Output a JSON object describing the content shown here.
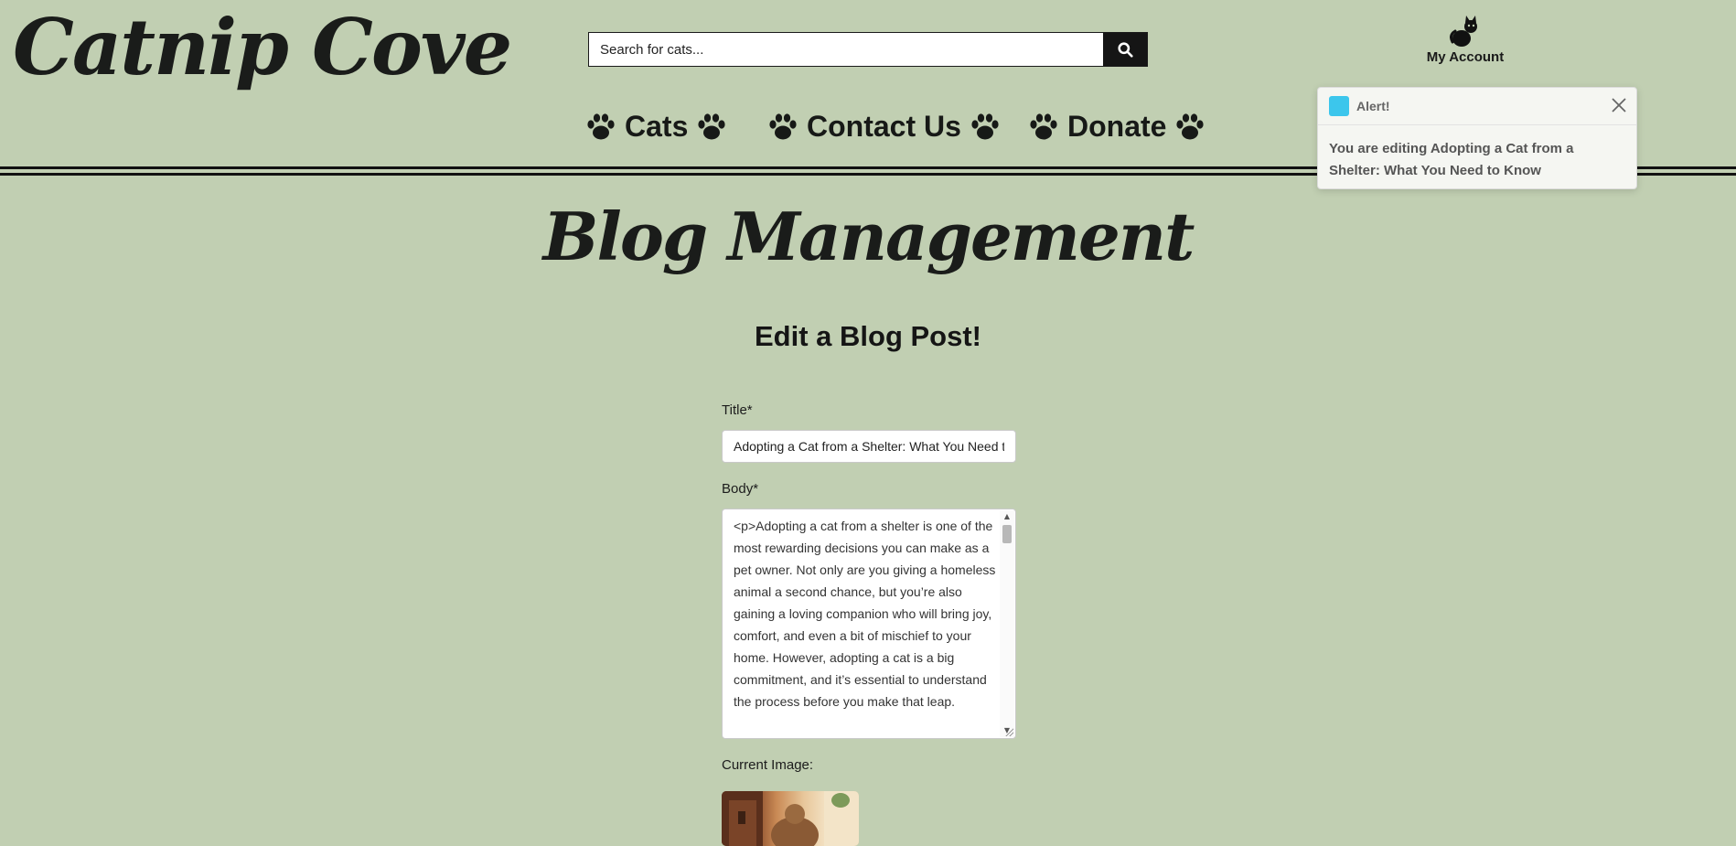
{
  "header": {
    "logo": "Catnip Cove",
    "search": {
      "placeholder": "Search for cats..."
    },
    "account_label": "My Account"
  },
  "nav": {
    "items": [
      {
        "label": "Cats"
      },
      {
        "label": "Contact Us"
      },
      {
        "label": "Donate"
      }
    ]
  },
  "main": {
    "heading": "Blog Management",
    "subheading": "Edit a Blog Post!",
    "form": {
      "title_label": "Title*",
      "title_value": "Adopting a Cat from a Shelter: What You Need to Know",
      "body_label": "Body*",
      "body_value": "<p>Adopting a cat from a shelter is one of the most rewarding decisions you can make as a pet owner. Not only are you giving a homeless animal a second chance, but you’re also gaining a loving companion who will bring joy, comfort, and even a bit of mischief to your home. However, adopting a cat is a big commitment, and it’s essential to understand the process before you make that leap.",
      "current_image_label": "Current Image:"
    }
  },
  "alert": {
    "title": "Alert!",
    "message": "You are editing Adopting a Cat from a Shelter: What You Need to Know",
    "accent_color": "#3cc6ec"
  },
  "colors": {
    "background": "#c1cfb2",
    "text": "#1b1d1b"
  }
}
